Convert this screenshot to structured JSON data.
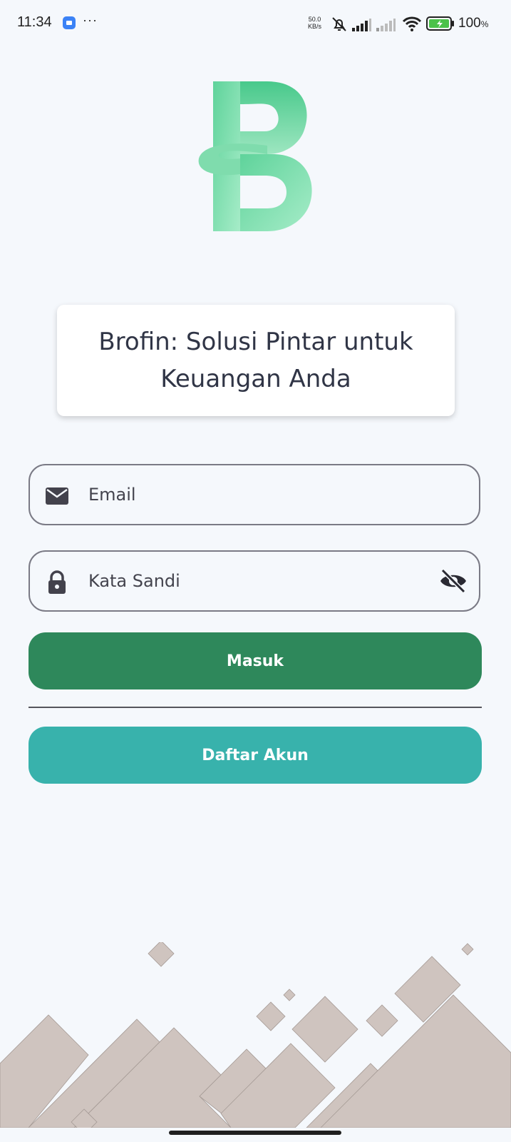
{
  "status_bar": {
    "time": "11:34",
    "more": "···",
    "network_speed_value": "50.0",
    "network_speed_unit": "KB/s",
    "battery_percent": "100",
    "battery_percent_sign": "%"
  },
  "brand": {
    "logo_icon": "brofin-b-logo",
    "tagline": "Brofin: Solusi Pintar untuk Keuangan Anda"
  },
  "form": {
    "email": {
      "placeholder": "Email",
      "value": "",
      "icon": "mail-icon"
    },
    "password": {
      "placeholder": "Kata Sandi",
      "value": "",
      "icon": "lock-icon",
      "toggle_icon": "eye-off-icon"
    },
    "login_label": "Masuk",
    "register_label": "Daftar Akun"
  },
  "colors": {
    "background": "#f5f8fc",
    "primary_green": "#2e885b",
    "teal": "#38b2ac",
    "logo_green": "#7fdcad",
    "decoration": "#cfc4bf"
  }
}
